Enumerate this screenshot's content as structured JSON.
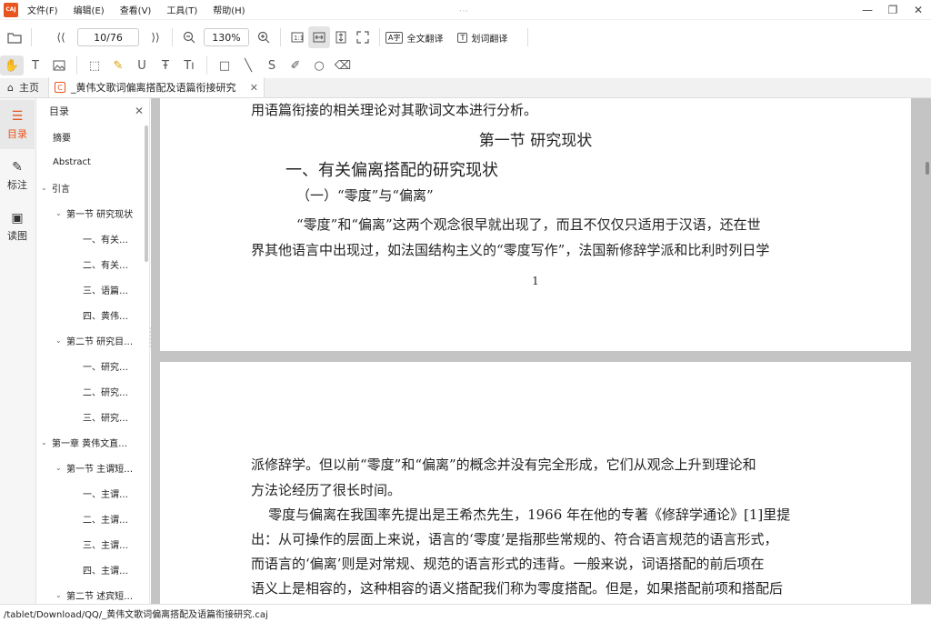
{
  "app": {
    "logo": "CAJ"
  },
  "menu": [
    "文件(F)",
    "编辑(E)",
    "查看(V)",
    "工具(T)",
    "帮助(H)"
  ],
  "toolbar": {
    "page_display": "10/76",
    "zoom": "130%",
    "full_translate": "全文翻译",
    "word_translate": "划词翻译"
  },
  "tabs": {
    "home": "主页",
    "document": "_黄伟文歌词偏离搭配及语篇衔接研究"
  },
  "rail": [
    {
      "label": "目录",
      "icon": "toc-list-icon"
    },
    {
      "label": "标注",
      "icon": "annotation-pen-icon"
    },
    {
      "label": "读图",
      "icon": "image-icon"
    }
  ],
  "toc": {
    "title": "目录",
    "items": [
      {
        "label": "摘要",
        "level": "lv0",
        "chev": ""
      },
      {
        "label": "Abstract",
        "level": "lv0",
        "chev": ""
      },
      {
        "label": "引言",
        "level": "lv0c",
        "chev": "⌄"
      },
      {
        "label": "第一节 研究现状",
        "level": "lv1c",
        "chev": "⌄"
      },
      {
        "label": "一、有关…",
        "level": "lv2",
        "chev": ""
      },
      {
        "label": "二、有关…",
        "level": "lv2",
        "chev": ""
      },
      {
        "label": "三、语篇…",
        "level": "lv2",
        "chev": ""
      },
      {
        "label": "四、黄伟…",
        "level": "lv2",
        "chev": ""
      },
      {
        "label": "第二节 研究目…",
        "level": "lv1c",
        "chev": "⌄"
      },
      {
        "label": "一、研究…",
        "level": "lv2",
        "chev": ""
      },
      {
        "label": "二、研究…",
        "level": "lv2",
        "chev": ""
      },
      {
        "label": "三、研究…",
        "level": "lv2",
        "chev": ""
      },
      {
        "label": "第一章 黄伟文直…",
        "level": "lv0c",
        "chev": "⌄"
      },
      {
        "label": "第一节 主谓短…",
        "level": "lv1c",
        "chev": "⌄"
      },
      {
        "label": "一、主谓…",
        "level": "lv2",
        "chev": ""
      },
      {
        "label": "二、主谓…",
        "level": "lv2",
        "chev": ""
      },
      {
        "label": "三、主谓…",
        "level": "lv2",
        "chev": ""
      },
      {
        "label": "四、主谓…",
        "level": "lv2",
        "chev": ""
      },
      {
        "label": "第二节 述宾短…",
        "level": "lv1c",
        "chev": "⌄"
      }
    ]
  },
  "document": {
    "page1": {
      "line_top": "用语篇衔接的相关理论对其歌词文本进行分析。",
      "section_title": "第一节  研究现状",
      "heading1": "一、有关偏离搭配的研究现状",
      "heading2": "（一）“零度”与“偏离”",
      "para1_line1": "“零度”和“偏离”这两个观念很早就出现了，而且不仅仅只适用于汉语，还在世",
      "para1_line2": "界其他语言中出现过，如法国结构主义的“零度写作”，法国新修辞学派和比利时列日学",
      "page_number": "1"
    },
    "page2": {
      "line1": "派修辞学。但以前“零度”和“偏离”的概念并没有完全形成，它们从观念上升到理论和",
      "line2": "方法论经历了很长时间。",
      "line3": "    零度与偏离在我国率先提出是王希杰先生，1966 年在他的专著《修辞学通论》[1]里提",
      "line4": "出：从可操作的层面上来说，语言的‘零度’是指那些常规的、符合语言规范的语言形式，",
      "line5": "而语言的‘偏离’则是对常规、规范的语言形式的违背。一般来说，词语搭配的前后项在",
      "line6": "语义上是相容的，这种相容的语义搭配我们称为零度搭配。但是，如果搭配前项和搭配后"
    }
  },
  "status": {
    "path": "/tablet/Download/QQ/_黄伟文歌词偏离搭配及语篇衔接研究.caj"
  }
}
